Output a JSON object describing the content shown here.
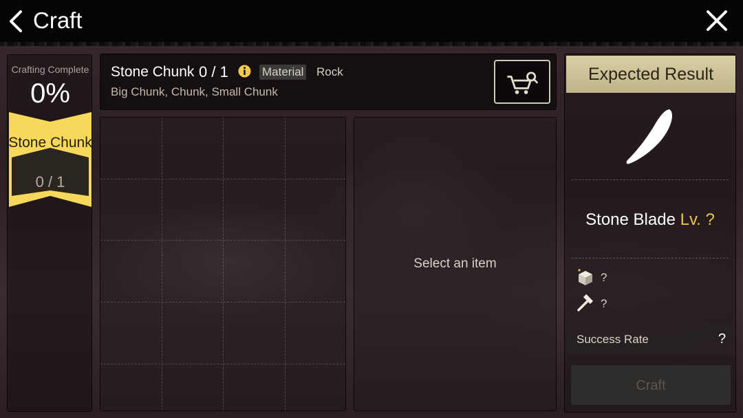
{
  "header": {
    "title": "Craft",
    "back_icon": "chevron-left-icon",
    "close_icon": "close-icon"
  },
  "progress": {
    "label": "Crafting Complete",
    "percent_text": "0%",
    "material_name": "Stone Chunk",
    "material_count": "0 / 1"
  },
  "material_info": {
    "name": "Stone Chunk",
    "count": "0 / 1",
    "tag_primary": "Material",
    "tag_secondary": "Rock",
    "variants": "Big Chunk, Chunk, Small Chunk",
    "shop_icon": "cart-search-icon"
  },
  "selection": {
    "placeholder": "Select an item"
  },
  "result": {
    "header": "Expected Result",
    "item_name": "Stone Blade",
    "level_text": "Lv. ?",
    "stat1_value": "?",
    "stat2_value": "?",
    "success_label": "Success Rate",
    "success_value": "?",
    "craft_label": "Craft"
  },
  "colors": {
    "accent_yellow": "#f6d85a",
    "level_gold": "#f2c24c"
  }
}
